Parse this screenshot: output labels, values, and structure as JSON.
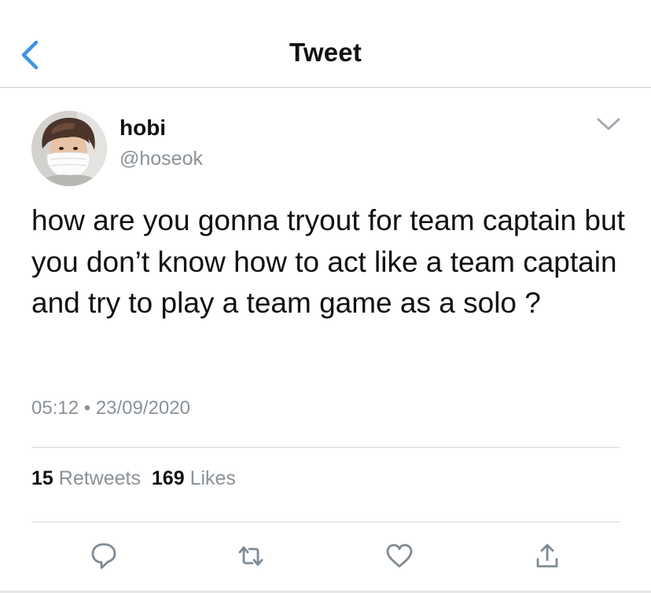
{
  "header": {
    "title": "Tweet",
    "back_icon": "chevron-left-icon"
  },
  "tweet": {
    "display_name": "hobi",
    "handle": "@hoseok",
    "text": "how are you gonna tryout for team captain but you don’t know how to act like a team captain and try to play a team game as a solo ?",
    "time": "05:12",
    "separator": "•",
    "date": "23/09/2020",
    "retweets_count": "15",
    "retweets_label": "Retweets",
    "likes_count": "169",
    "likes_label": "Likes"
  },
  "actions": [
    {
      "name": "reply",
      "icon": "reply-icon"
    },
    {
      "name": "retweet",
      "icon": "retweet-icon"
    },
    {
      "name": "like",
      "icon": "heart-icon"
    },
    {
      "name": "share",
      "icon": "share-icon"
    }
  ],
  "colors": {
    "accent": "#1da1f2",
    "secondary_text": "#8a9198",
    "icon_gray": "#7f8a93"
  }
}
